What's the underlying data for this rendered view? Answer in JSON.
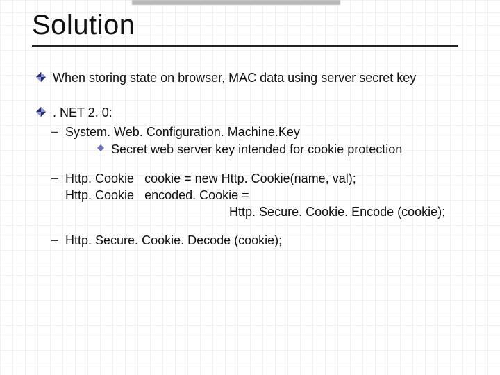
{
  "slide": {
    "title": "Solution",
    "bullets": [
      {
        "text": "When storing state on browser, MAC data using server secret key"
      },
      {
        "text": ". NET 2. 0:",
        "subs": [
          {
            "text": "System. Web. Configuration. Machine.Key",
            "subsubs": [
              {
                "text": "Secret web server key intended for cookie protection"
              }
            ]
          },
          {
            "lines": [
              "Http. Cookie   cookie = new Http. Cookie(name, val);",
              "Http. Cookie   encoded. Cookie =",
              "                        Http. Secure. Cookie. Encode (cookie);"
            ]
          },
          {
            "text": "Http. Secure. Cookie. Decode (cookie);"
          }
        ]
      }
    ]
  },
  "colors": {
    "diamond_dark": "#2a2f6a",
    "diamond_light": "#8f95d8",
    "subdiamond": "#6b6fb3"
  }
}
